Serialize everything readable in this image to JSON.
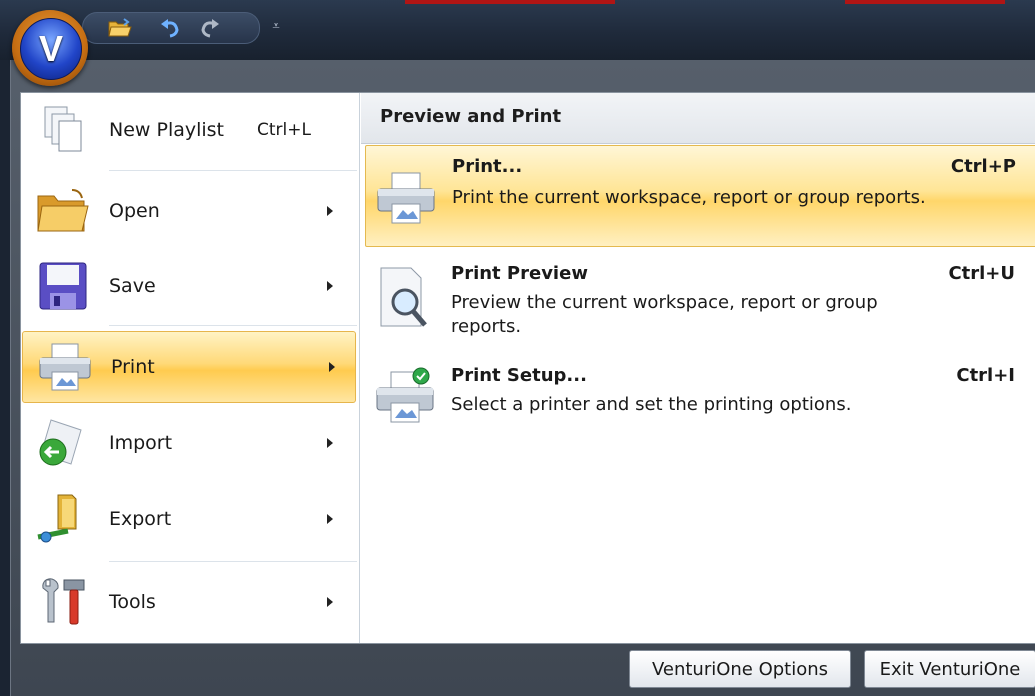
{
  "app": {
    "orb_letter": "V",
    "accent": "#ffd66a",
    "titlebar_color": "#1f2a3b"
  },
  "quick_access": {
    "items": [
      {
        "name": "open-folder-icon"
      },
      {
        "name": "undo-icon"
      },
      {
        "name": "redo-icon"
      }
    ],
    "customize_glyph": "⩡"
  },
  "left_menu": {
    "items": [
      {
        "label": "New Playlist",
        "shortcut": "Ctrl+L",
        "icon": "new-document-icon",
        "has_submenu": false
      },
      {
        "label": "Open",
        "shortcut": "",
        "icon": "open-folder-icon",
        "has_submenu": true
      },
      {
        "label": "Save",
        "shortcut": "",
        "icon": "floppy-disk-icon",
        "has_submenu": true
      },
      {
        "label": "Print",
        "shortcut": "",
        "icon": "printer-icon",
        "has_submenu": true,
        "selected": true
      },
      {
        "label": "Import",
        "shortcut": "",
        "icon": "import-icon",
        "has_submenu": true
      },
      {
        "label": "Export",
        "shortcut": "",
        "icon": "export-icon",
        "has_submenu": true
      },
      {
        "label": "Tools",
        "shortcut": "",
        "icon": "tools-icon",
        "has_submenu": true
      }
    ]
  },
  "right_panel": {
    "header": "Preview and Print",
    "entries": [
      {
        "title": "Print...",
        "shortcut": "Ctrl+P",
        "description": "Print the current workspace, report or group reports.",
        "icon": "printer-icon",
        "highlighted": true
      },
      {
        "title": "Print Preview",
        "shortcut": "Ctrl+U",
        "description": "Preview the current workspace, report or group reports.",
        "icon": "print-preview-icon",
        "highlighted": false
      },
      {
        "title": "Print Setup...",
        "shortcut": "Ctrl+I",
        "description": "Select a printer and set the printing options.",
        "icon": "printer-setup-icon",
        "highlighted": false
      }
    ]
  },
  "footer": {
    "options_label": "VenturiOne Options",
    "exit_label": "Exit VenturiOne"
  }
}
